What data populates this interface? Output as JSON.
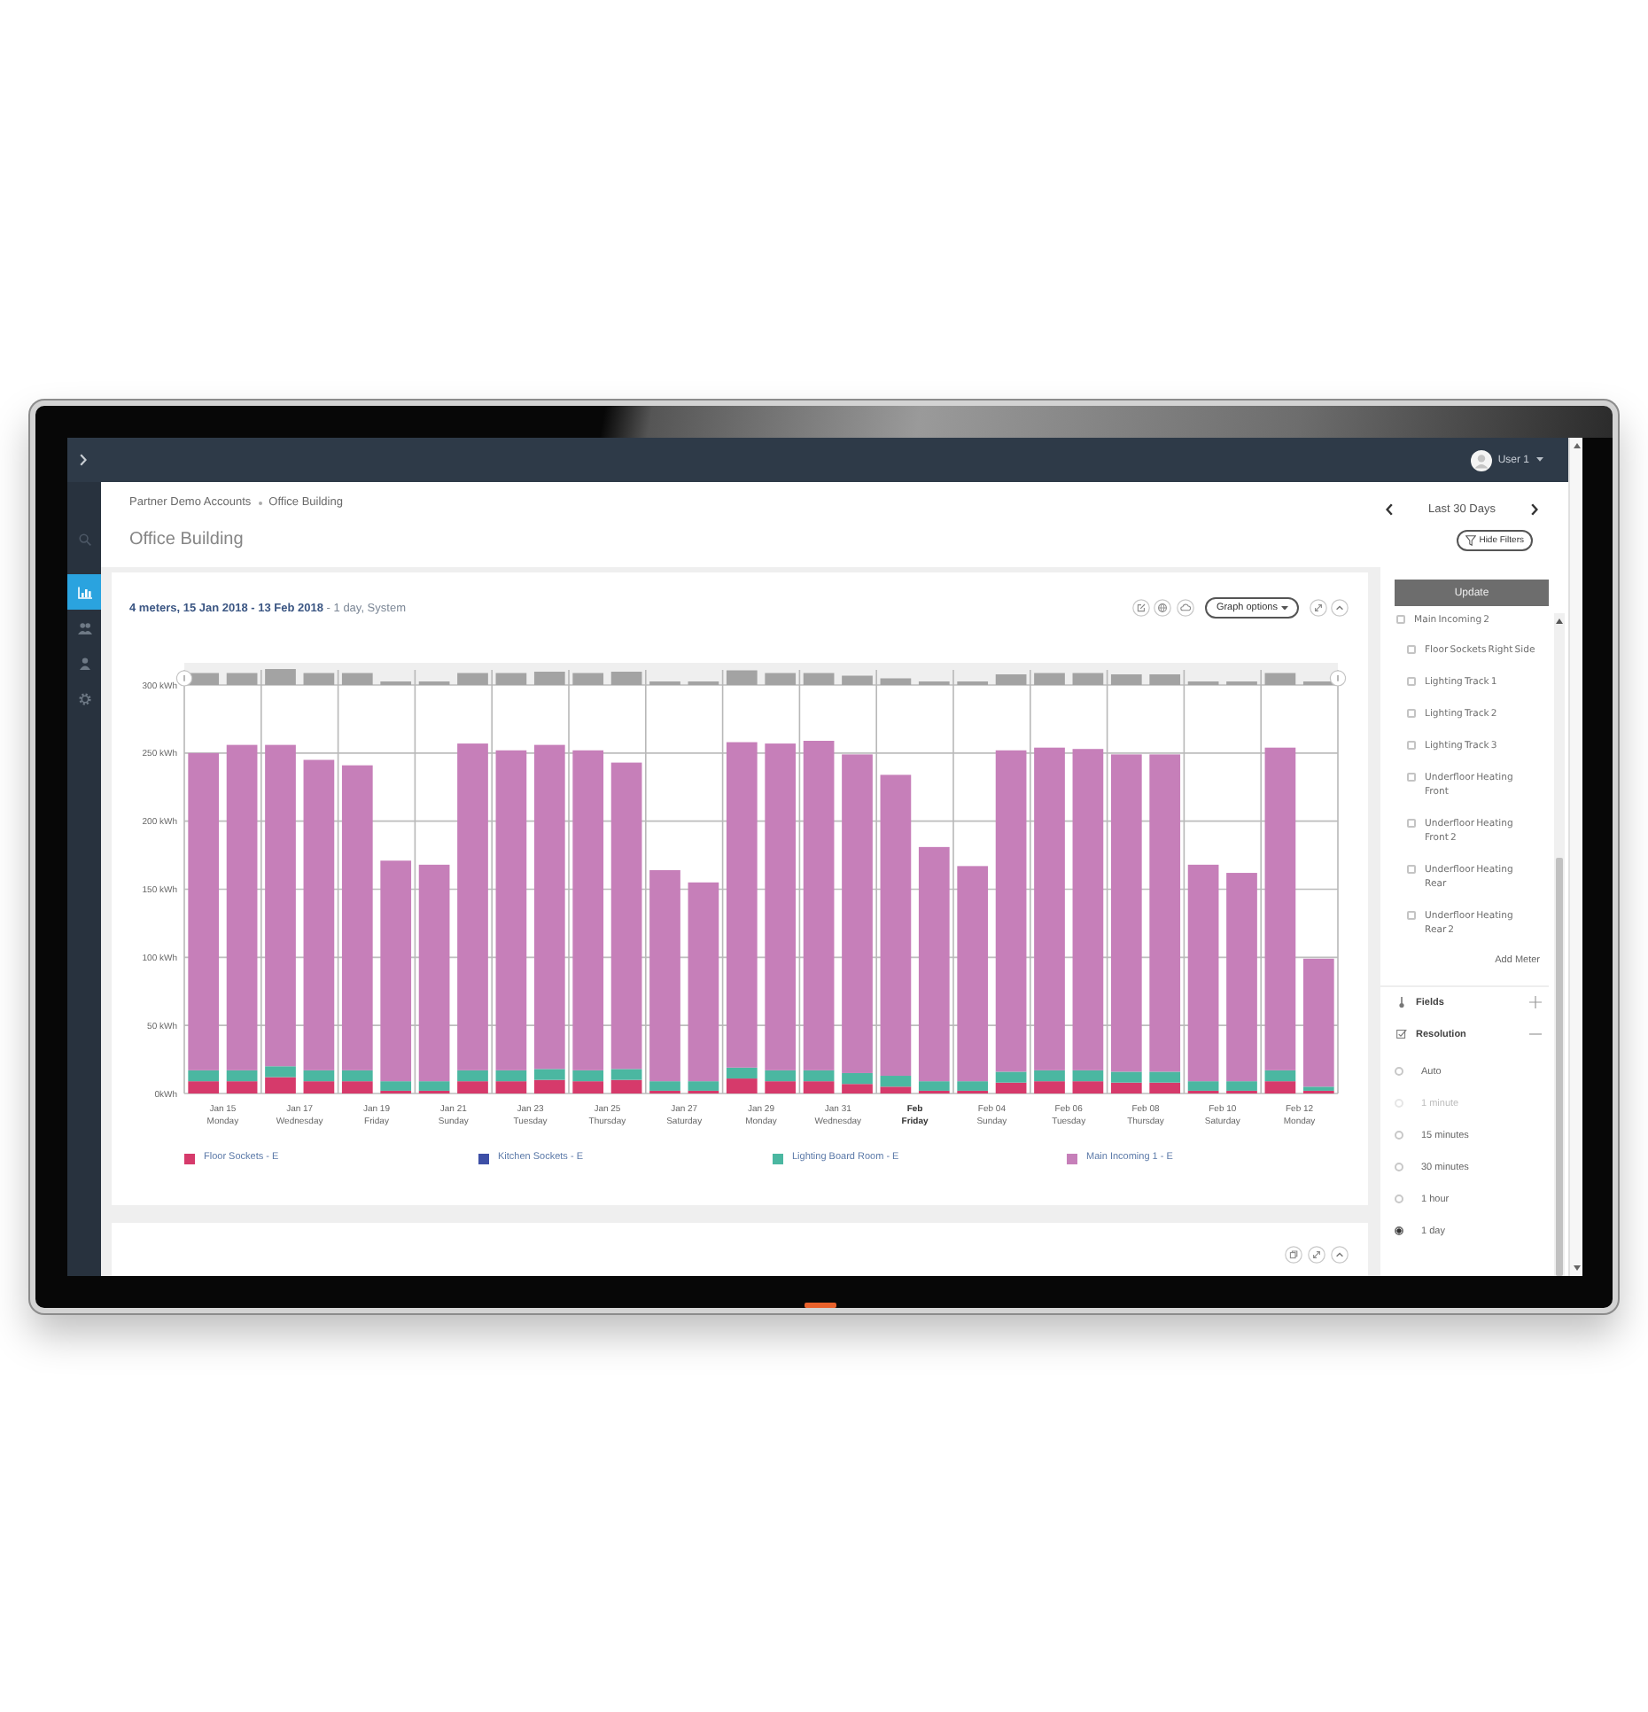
{
  "top_bar": {
    "user": "User 1"
  },
  "sidebar": {
    "items": [
      {
        "kind": "search",
        "selected": false
      },
      {
        "kind": "chart",
        "selected": true
      },
      {
        "kind": "users",
        "selected": false
      },
      {
        "kind": "person",
        "selected": false
      },
      {
        "kind": "gear",
        "selected": false
      }
    ]
  },
  "header": {
    "breadcrumb": [
      "Partner Demo Accounts",
      "Office Building"
    ],
    "title": "Office Building",
    "date_range": "Last 30 Days",
    "filters_button": "Hide Filters"
  },
  "chart_card": {
    "heading": "**4 meters, 15 Jan 2018 - 13 Feb 2018** - 1 day, System",
    "options_button": "Graph options",
    "chart_data": {
      "type": "bar",
      "stacked": true,
      "grid": true,
      "legend": "bottom",
      "categories": [
        "Jan 15\nMonday",
        null,
        "Jan 17\nWednesday",
        null,
        "Jan 19\nFriday",
        null,
        "Jan 21\nSunday",
        null,
        "Jan 23\nTuesday",
        null,
        "Jan 25\nThursday",
        null,
        "Jan 27\nSaturday",
        null,
        "Jan 29\nMonday",
        null,
        "Jan 31\nWednesday",
        null,
        "Feb\nFriday",
        null,
        "Feb 04\nSunday",
        null,
        "Feb 06\nTuesday",
        null,
        "Feb 08\nThursday",
        null,
        "Feb 10\nSaturday",
        null,
        "Feb 12\nMonday",
        null
      ],
      "series": [
        {
          "name": "Floor Sockets - E",
          "color": "#d63a6b",
          "values": [
            9,
            9,
            12,
            9,
            9,
            2,
            2,
            9,
            9,
            10,
            9,
            10,
            2,
            2,
            11,
            9,
            9,
            7,
            5,
            2,
            2,
            8,
            9,
            9,
            8,
            8,
            2,
            2,
            9,
            2
          ]
        },
        {
          "name": "Kitchen Sockets - E",
          "color": "#3d4fa6",
          "values": [
            0,
            0,
            0,
            0,
            0,
            0,
            0,
            0,
            0,
            0,
            0,
            0,
            0,
            0,
            0,
            0,
            0,
            0,
            0,
            0,
            0,
            0,
            0,
            0,
            0,
            0,
            0,
            0,
            0,
            0
          ]
        },
        {
          "name": "Lighting Board Room - E",
          "color": "#4bb7a1",
          "values": [
            8,
            8,
            8,
            8,
            8,
            7,
            7,
            8,
            8,
            8,
            8,
            8,
            7,
            7,
            8,
            8,
            8,
            8,
            8,
            7,
            7,
            8,
            8,
            8,
            8,
            8,
            7,
            7,
            8,
            3
          ]
        },
        {
          "name": "Main Incoming 1 - E",
          "color": "#c67fb9",
          "values": [
            233,
            239,
            236,
            228,
            224,
            162,
            159,
            240,
            235,
            238,
            235,
            225,
            155,
            146,
            239,
            240,
            242,
            234,
            221,
            172,
            158,
            236,
            237,
            236,
            233,
            233,
            159,
            153,
            237,
            94
          ]
        }
      ],
      "ylim": [
        0,
        300
      ],
      "yticks": [
        {
          "value": 0,
          "label": "0kWh"
        },
        {
          "value": 50,
          "label": "50 kWh"
        },
        {
          "value": 100,
          "label": "100 kWh"
        },
        {
          "value": 150,
          "label": "150 kWh"
        },
        {
          "value": 200,
          "label": "200 kWh"
        },
        {
          "value": 250,
          "label": "250 kWh"
        },
        {
          "value": 300,
          "label": "300 kWh"
        }
      ]
    }
  },
  "filters": {
    "update_button": "Update",
    "meters": [
      {
        "label": "Main Incoming 2",
        "checked": false,
        "children": [
          {
            "label": "Floor Sockets Right Side",
            "checked": false
          },
          {
            "label": "Lighting Track 1",
            "checked": false
          },
          {
            "label": "Lighting Track 2",
            "checked": false
          },
          {
            "label": "Lighting Track 3",
            "checked": false
          },
          {
            "label": "Underfloor Heating Front",
            "checked": false
          },
          {
            "label": "Underfloor Heating Front 2",
            "checked": false
          },
          {
            "label": "Underfloor Heating Rear",
            "checked": false
          },
          {
            "label": "Underfloor Heating Rear 2",
            "checked": false
          }
        ]
      }
    ],
    "add_meter": "Add Meter",
    "sections": [
      {
        "kind": "fields",
        "label": "Fields",
        "expanded": false
      },
      {
        "kind": "resolution",
        "label": "Resolution",
        "expanded": true,
        "options": [
          {
            "label": "Auto",
            "selected": false,
            "disabled": false
          },
          {
            "label": "1 minute",
            "selected": false,
            "disabled": true
          },
          {
            "label": "15 minutes",
            "selected": false,
            "disabled": false
          },
          {
            "label": "30 minutes",
            "selected": false,
            "disabled": false
          },
          {
            "label": "1 hour",
            "selected": false,
            "disabled": false
          },
          {
            "label": "1 day",
            "selected": true,
            "disabled": false
          }
        ]
      }
    ]
  }
}
